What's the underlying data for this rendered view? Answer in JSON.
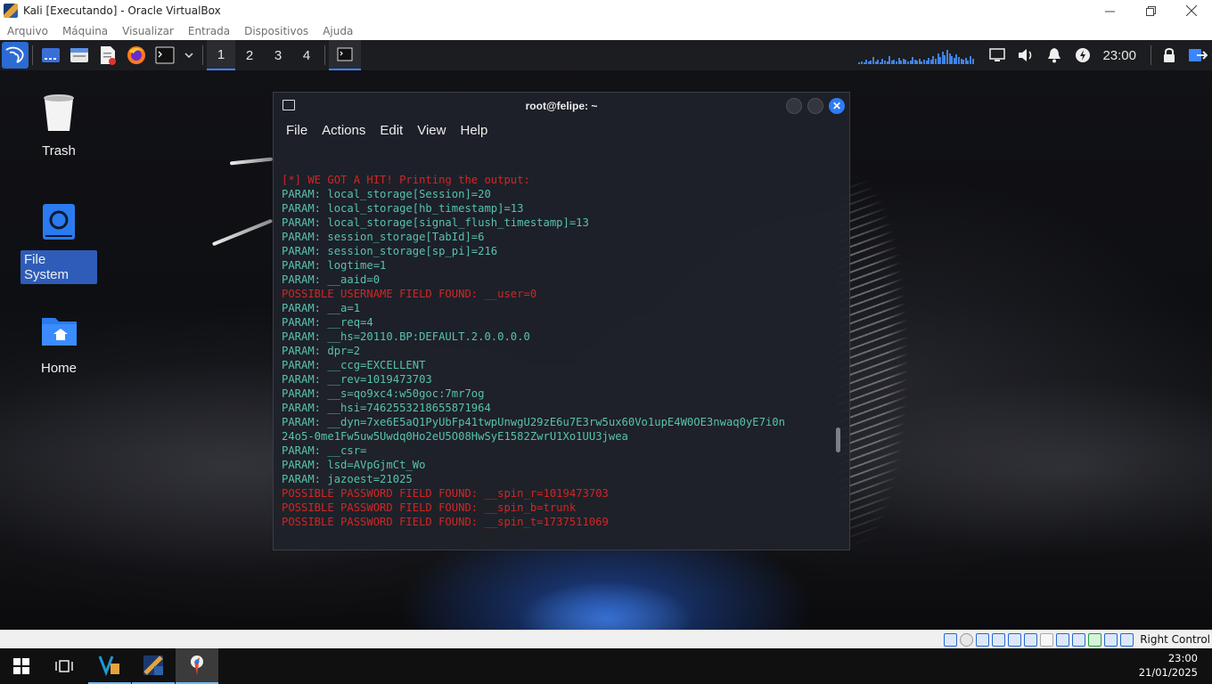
{
  "host_window": {
    "title": "Kali [Executando] - Oracle VirtualBox",
    "menu": [
      "Arquivo",
      "Máquina",
      "Visualizar",
      "Entrada",
      "Dispositivos",
      "Ajuda"
    ]
  },
  "panel": {
    "workspaces": [
      "1",
      "2",
      "3",
      "4"
    ],
    "active_workspace": "1",
    "clock": "23:00"
  },
  "desktop_icons": [
    {
      "label": "Trash",
      "icon": "trash-icon"
    },
    {
      "label": "File System",
      "icon": "drive-icon"
    },
    {
      "label": "Home",
      "icon": "home-folder-icon"
    }
  ],
  "terminal": {
    "title": "root@felipe: ~",
    "menu": [
      "File",
      "Actions",
      "Edit",
      "View",
      "Help"
    ],
    "lines": [
      {
        "text": "[*] WE GOT A HIT! Printing the output:",
        "color": "red"
      },
      {
        "text": "PARAM: local_storage[Session]=20",
        "color": "teal"
      },
      {
        "text": "PARAM: local_storage[hb_timestamp]=13",
        "color": "teal"
      },
      {
        "text": "PARAM: local_storage[signal_flush_timestamp]=13",
        "color": "teal"
      },
      {
        "text": "PARAM: session_storage[TabId]=6",
        "color": "teal"
      },
      {
        "text": "PARAM: session_storage[sp_pi]=216",
        "color": "teal"
      },
      {
        "text": "PARAM: logtime=1",
        "color": "teal"
      },
      {
        "text": "PARAM: __aaid=0",
        "color": "teal"
      },
      {
        "text": "POSSIBLE USERNAME FIELD FOUND: __user=0",
        "color": "red"
      },
      {
        "text": "PARAM: __a=1",
        "color": "teal"
      },
      {
        "text": "PARAM: __req=4",
        "color": "teal"
      },
      {
        "text": "PARAM: __hs=20110.BP:DEFAULT.2.0.0.0.0",
        "color": "teal"
      },
      {
        "text": "PARAM: dpr=2",
        "color": "teal"
      },
      {
        "text": "PARAM: __ccg=EXCELLENT",
        "color": "teal"
      },
      {
        "text": "PARAM: __rev=1019473703",
        "color": "teal"
      },
      {
        "text": "PARAM: __s=qo9xc4:w50goc:7mr7og",
        "color": "teal"
      },
      {
        "text": "PARAM: __hsi=7462553218655871964",
        "color": "teal"
      },
      {
        "text": "PARAM: __dyn=7xe6E5aQ1PyUbFp41twpUnwgU29zE6u7E3rw5ux60Vo1upE4W0OE3nwaq0yE7i0n",
        "color": "teal"
      },
      {
        "text": "24o5-0me1Fw5uw5Uwdq0Ho2eU5O08HwSyE1582ZwrU1Xo1UU3jwea",
        "color": "teal"
      },
      {
        "text": "PARAM: __csr=",
        "color": "teal"
      },
      {
        "text": "PARAM: lsd=AVpGjmCt_Wo",
        "color": "teal"
      },
      {
        "text": "PARAM: jazoest=21025",
        "color": "teal"
      },
      {
        "text": "POSSIBLE PASSWORD FIELD FOUND: __spin_r=1019473703",
        "color": "red"
      },
      {
        "text": "POSSIBLE PASSWORD FIELD FOUND: __spin_b=trunk",
        "color": "red"
      },
      {
        "text": "POSSIBLE PASSWORD FIELD FOUND: __spin_t=1737511069",
        "color": "red"
      }
    ]
  },
  "statusbar": {
    "host_key": "Right Control"
  },
  "taskbar": {
    "time": "23:00",
    "date": "21/01/2025"
  },
  "colors": {
    "kali_blue": "#2b6bd3",
    "terminal_text": "#57c2ad",
    "terminal_alert": "#d02626",
    "accent": "#3a86ff"
  }
}
